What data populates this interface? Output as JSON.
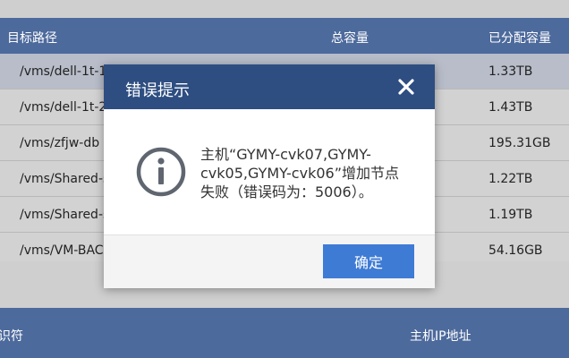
{
  "table": {
    "headers": [
      "目标路径",
      "总容量",
      "已分配容量"
    ],
    "rows": [
      {
        "path": "/vms/dell-1t-1",
        "allocated": "1.33TB"
      },
      {
        "path": "/vms/dell-1t-2",
        "allocated": "1.43TB"
      },
      {
        "path": "/vms/zfjw-db",
        "allocated": "195.31GB"
      },
      {
        "path": "/vms/Shared-s",
        "allocated": "1.22TB"
      },
      {
        "path": "/vms/Shared-s",
        "allocated": "1.19TB"
      },
      {
        "path": "/vms/VM-BAC",
        "allocated": "54.16GB"
      }
    ]
  },
  "table2": {
    "headers": [
      "识符",
      "主机IP地址"
    ]
  },
  "dialog": {
    "title": "错误提示",
    "message": "主机“GYMY-cvk07,GYMY-cvk05,GYMY-cvk06”增加节点失败（错误码为：5006）。",
    "ok_label": "确定",
    "icon": "info-icon",
    "close_icon": "close-icon"
  },
  "colors": {
    "header_bg": "#4d6a9c",
    "dialog_header_bg": "#2e4e82",
    "button_bg": "#3e7bd5"
  }
}
